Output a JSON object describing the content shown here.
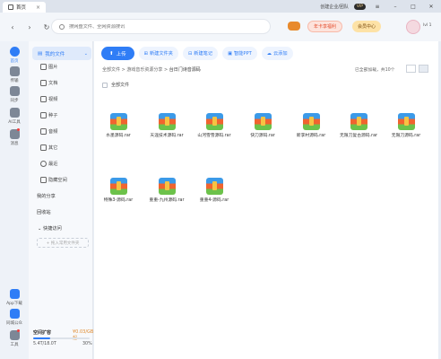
{
  "tab": {
    "title": "首页"
  },
  "titlebar": {
    "org_label": "创建企业/团队",
    "vip_badge": "VIP"
  },
  "nav": {
    "back": "‹",
    "forward": "›",
    "refresh": "↻"
  },
  "search": {
    "placeholder": "搜网盘文件、全网资源搜讯"
  },
  "header": {
    "promo_label": "年卡享福利",
    "member_label": "会员中心",
    "level_label": "lvl 1"
  },
  "rail": [
    {
      "label": "首页"
    },
    {
      "label": "传输"
    },
    {
      "label": "同步"
    },
    {
      "label": "AI工具"
    },
    {
      "label": "消息"
    },
    {
      "label": "App下载"
    },
    {
      "label": "同城公众"
    },
    {
      "label": "工具"
    }
  ],
  "sidebar": {
    "mydisk": "我的文件",
    "items": [
      "图片",
      "文档",
      "视频",
      "种子",
      "音频",
      "其它",
      "最近",
      "隐藏空间"
    ],
    "share": "我的分享",
    "recycle": "回收站",
    "quick_title": "快捷访问",
    "quick_add": "+ 拖入常用文件夹",
    "storage": {
      "label": "空间扩容",
      "price": "¥0.03/GB起",
      "used": "5.4T/18.0T",
      "percent": "30%",
      "fill": 0.3
    }
  },
  "actions": {
    "upload": "上传",
    "new_folder": "新建文件夹",
    "new_note": "新建笔记",
    "smart_ppt": "智能PPT",
    "cloud_add": "云添加"
  },
  "breadcrumb": {
    "root": "全部文件",
    "sep1": " > ",
    "mid": "游戏音乐资源分享",
    "sep2": " > ",
    "current": "台日门诗音源码"
  },
  "count_label": "已全部加载，共10个",
  "select_all": "全部文件",
  "files": [
    "水墨源码.rar",
    "天涯技术源码.rar",
    "山河雪雪源码.rar",
    "快刀源码.rar",
    "新李村源码.rar",
    "无限刀复古源码.rar",
    "无限刀源码.rar",
    "特殊3-源码.rar",
    "重重-九州源码.rar",
    "重重4-源码.rar"
  ]
}
